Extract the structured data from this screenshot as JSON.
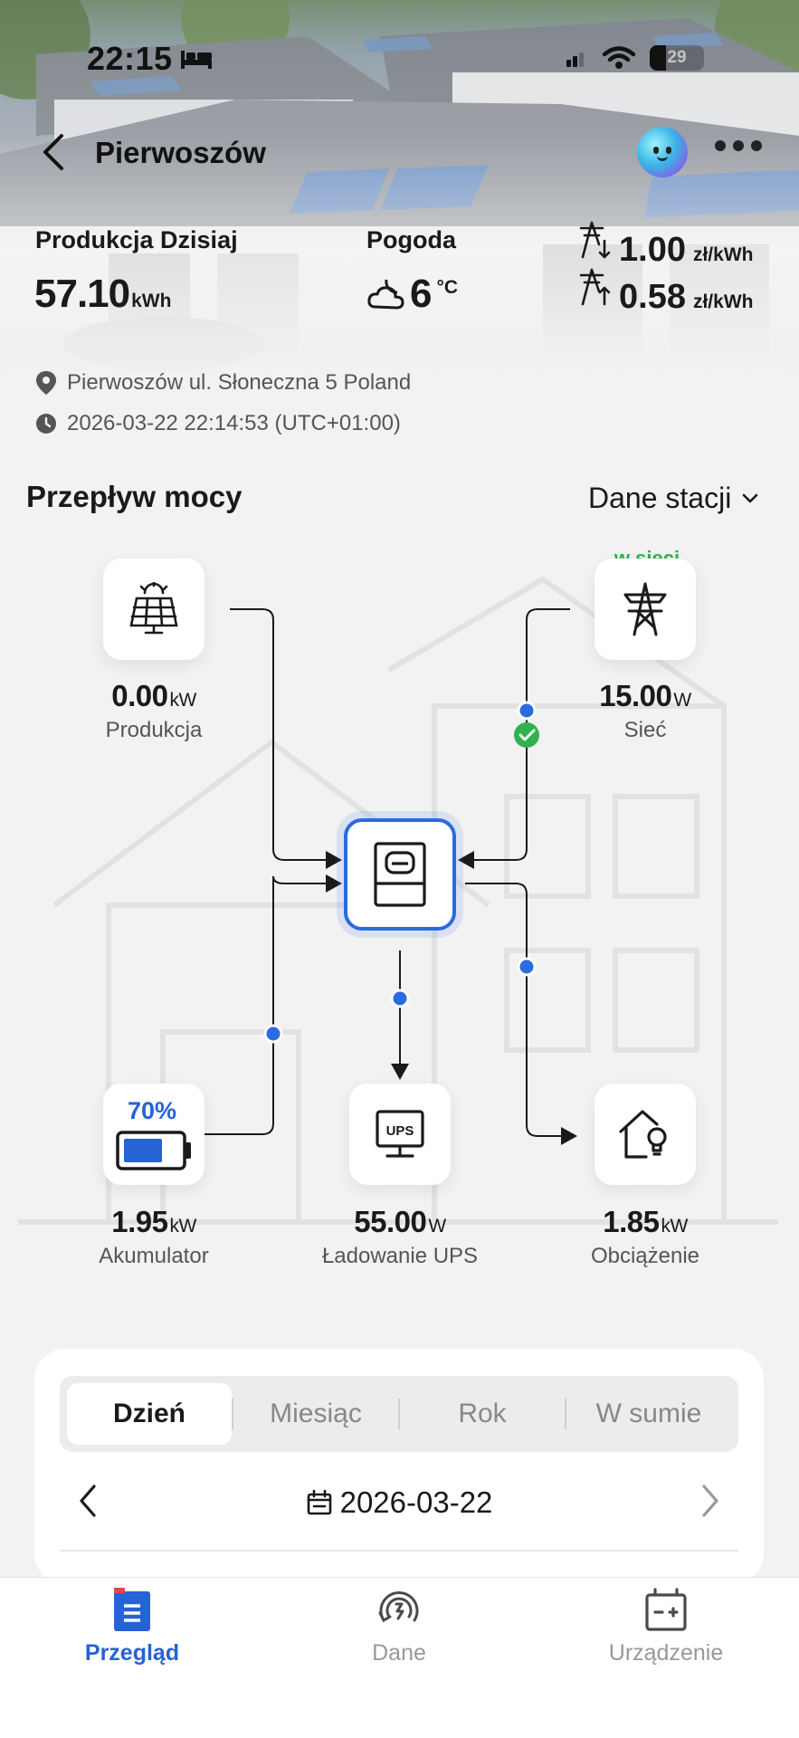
{
  "status_bar": {
    "time": "22:15",
    "battery_level": "29"
  },
  "header": {
    "title": "Pierwoszów"
  },
  "summary": {
    "production_label": "Produkcja Dzisiaj",
    "production_value": "57.10",
    "production_unit": "kWh",
    "weather_label": "Pogoda",
    "weather_value": "6",
    "weather_unit": "°C",
    "price_buy": "1.00",
    "price_sell": "0.58",
    "price_unit": "zł/kWh"
  },
  "info": {
    "address": "Pierwoszów ul. Słoneczna 5 Poland",
    "timestamp": "2026-03-22 22:14:53 (UTC+01:00)"
  },
  "power_flow": {
    "title": "Przepływ mocy",
    "dropdown_label": "Dane stacji",
    "nodes": {
      "production": {
        "value": "0.00",
        "unit": "kW",
        "label": "Produkcja"
      },
      "grid": {
        "status": "w sieci",
        "value": "15.00",
        "unit": "W",
        "label": "Sieć"
      },
      "battery": {
        "percent": "70%",
        "soc": 0.7,
        "value": "1.95",
        "unit": "kW",
        "label": "Akumulator"
      },
      "ups": {
        "icon_text": "UPS",
        "value": "55.00",
        "unit": "W",
        "label": "Ładowanie UPS"
      },
      "load": {
        "value": "1.85",
        "unit": "kW",
        "label": "Obciążenie"
      }
    }
  },
  "period": {
    "tabs": [
      "Dzień",
      "Miesiąc",
      "Rok",
      "W sumie"
    ],
    "active_tab": "Dzień",
    "date": "2026-03-22"
  },
  "tabbar": {
    "items": [
      {
        "label": "Przegląd",
        "icon": "overview-icon",
        "active": true
      },
      {
        "label": "Dane",
        "icon": "data-icon",
        "active": false
      },
      {
        "label": "Urządzenie",
        "icon": "device-icon",
        "active": false
      }
    ]
  },
  "colors": {
    "accent": "#2563d6",
    "online": "#2fb34a",
    "background": "#f2f2f3"
  }
}
